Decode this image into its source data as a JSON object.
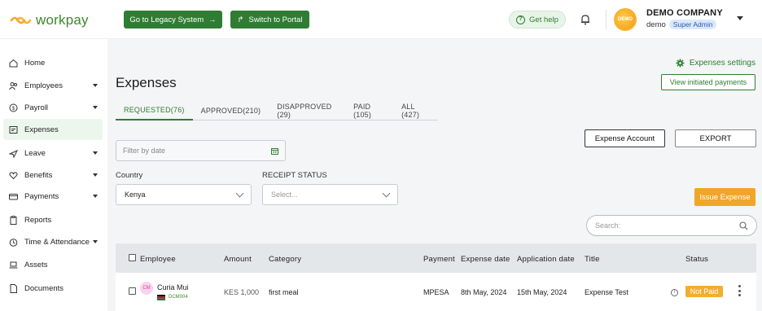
{
  "brand": {
    "name": "workpay",
    "color": "#3a8a2a"
  },
  "topbar": {
    "legacy_button": "Go to Legacy System",
    "portal_button": "Switch to Portal",
    "help_label": "Get help",
    "company_name": "DEMO COMPANY",
    "username": "demo",
    "role": "Super Admin",
    "avatar_text": "DEMO"
  },
  "sidebar": {
    "items": [
      {
        "label": "Home",
        "icon": "home-icon"
      },
      {
        "label": "Employees",
        "icon": "users-icon",
        "expandable": true
      },
      {
        "label": "Payroll",
        "icon": "dollar-icon",
        "expandable": true
      },
      {
        "label": "Expenses",
        "icon": "receipt-icon",
        "active": true
      },
      {
        "label": "Leave",
        "icon": "plane-icon",
        "expandable": true
      },
      {
        "label": "Benefits",
        "icon": "heart-icon",
        "expandable": true
      },
      {
        "label": "Payments",
        "icon": "card-icon",
        "expandable": true
      },
      {
        "label": "Reports",
        "icon": "clipboard-icon"
      },
      {
        "label": "Time & Attendance",
        "icon": "clock-icon",
        "expandable": true
      },
      {
        "label": "Assets",
        "icon": "laptop-icon"
      },
      {
        "label": "Documents",
        "icon": "document-icon"
      }
    ]
  },
  "page": {
    "title": "Expenses",
    "settings_label": "Expenses settings",
    "view_initiated": "View initiated payments",
    "tabs": [
      {
        "label": "REQUESTED(76)",
        "active": true
      },
      {
        "label": "APPROVED(210)"
      },
      {
        "label": "DISAPPROVED (29)"
      },
      {
        "label": "PAID (105)"
      },
      {
        "label": "ALL (427)"
      }
    ],
    "expense_account_button": "Expense Account",
    "export_button": "EXPORT",
    "date_filter_placeholder": "Filter by date",
    "country_label": "Country",
    "country_value": "Kenya",
    "receipt_status_label": "RECEIPT STATUS",
    "receipt_status_placeholder": "Select...",
    "issue_expense_button": "Issue Expense",
    "search_placeholder": "Search:"
  },
  "table": {
    "columns": [
      "Employee",
      "Amount",
      "Category",
      "Payment",
      "Expense date",
      "Application date",
      "Title",
      "Status"
    ],
    "rows": [
      {
        "initials": "CM",
        "employee": "Curia Mui",
        "code": "DCM004",
        "amount": "KES 1,000",
        "category": "first meal",
        "payment": "MPESA",
        "expense_date": "8th May, 2024",
        "application_date": "15th May, 2024",
        "title": "Expense Test",
        "status": "Not Paid"
      }
    ]
  },
  "colors": {
    "primary_green": "#2f7d32",
    "accent_orange": "#f2a529",
    "status_not_paid": "#f4ad2e"
  }
}
